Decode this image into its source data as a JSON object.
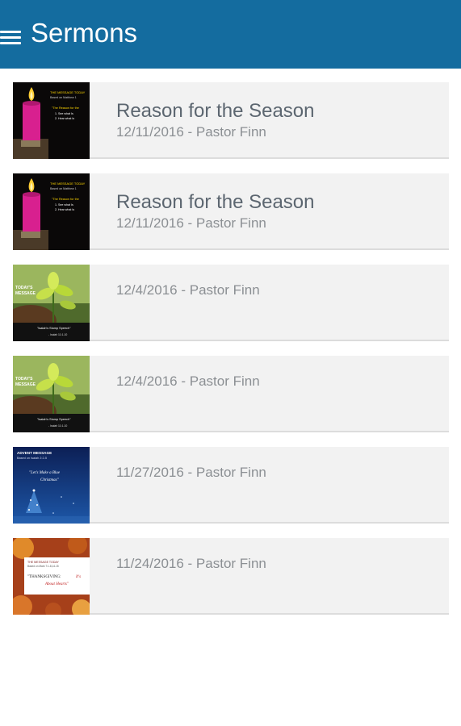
{
  "app": {
    "title": "Sermons"
  },
  "sermons": [
    {
      "title": "Reason for the Season",
      "meta": "12/11/2016 - Pastor Finn",
      "thumb": "candle"
    },
    {
      "title": "Reason for the Season",
      "meta": "12/11/2016 - Pastor Finn",
      "thumb": "candle"
    },
    {
      "title": "",
      "meta": "12/4/2016 - Pastor Finn",
      "thumb": "plant"
    },
    {
      "title": "",
      "meta": "12/4/2016 - Pastor Finn",
      "thumb": "plant"
    },
    {
      "title": "",
      "meta": "11/27/2016 - Pastor Finn",
      "thumb": "advent"
    },
    {
      "title": "",
      "meta": "11/24/2016 - Pastor Finn",
      "thumb": "thanksgiving"
    }
  ]
}
